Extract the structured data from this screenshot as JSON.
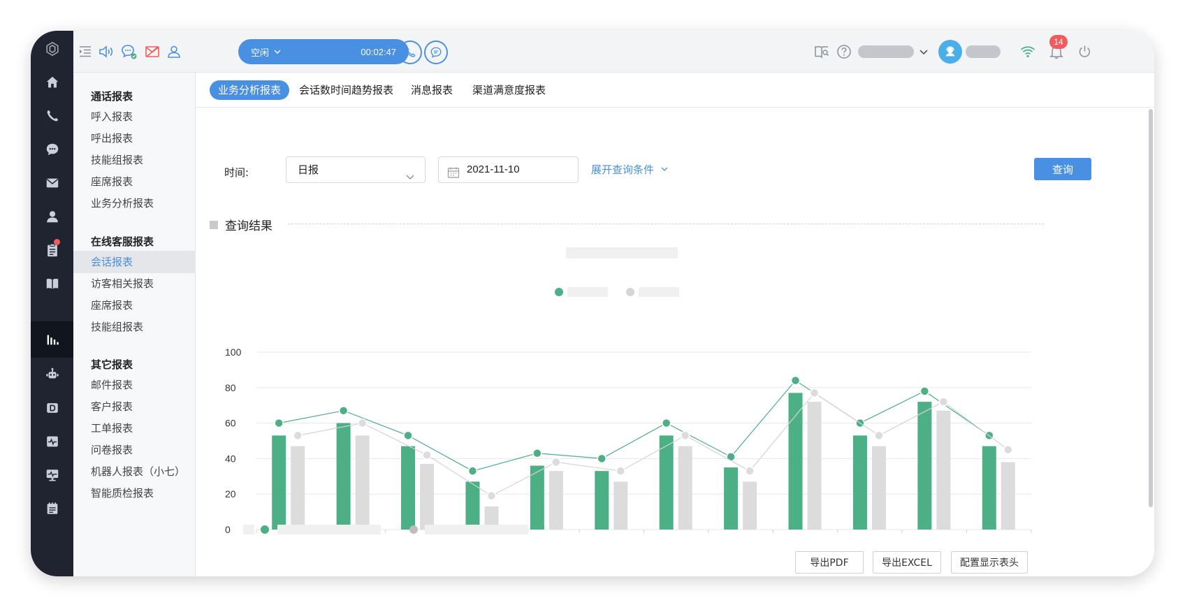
{
  "topbar": {
    "status_label": "空闲",
    "timer": "00:02:47",
    "notification_count": "14"
  },
  "submenu": {
    "groups": [
      {
        "title": "通话报表",
        "items": [
          "呼入报表",
          "呼出报表",
          "技能组报表",
          "座席报表",
          "业务分析报表"
        ]
      },
      {
        "title": "在线客服报表",
        "items": [
          "会话报表",
          "访客相关报表",
          "座席报表",
          "技能组报表"
        ]
      },
      {
        "title": "其它报表",
        "items": [
          "邮件报表",
          "客户报表",
          "工单报表",
          "问卷报表",
          "机器人报表（小七）",
          "智能质检报表"
        ]
      }
    ],
    "active_item": "会话报表"
  },
  "tabs": [
    "业务分析报表",
    "会话数时间趋势报表",
    "消息报表",
    "渠道满意度报表"
  ],
  "filters": {
    "time_label": "时间:",
    "period_value": "日报",
    "date_value": "2021-11-10",
    "expand_label": "展开查询条件",
    "query_button": "查询"
  },
  "results": {
    "title": "查询结果"
  },
  "chart_data": {
    "type": "bar",
    "title": "",
    "categories": [
      "",
      "",
      "",
      "",
      "",
      "",
      "",
      "",
      "",
      "",
      "",
      ""
    ],
    "ylim": [
      0,
      100
    ],
    "yticks": [
      "100",
      "80",
      "60",
      "40",
      "20",
      "0"
    ],
    "grid": true,
    "series": [
      {
        "kind": "bar",
        "color": "#4caf85",
        "values": [
          53,
          60,
          47,
          27,
          36,
          33,
          53,
          35,
          77,
          53,
          72,
          47
        ]
      },
      {
        "kind": "bar",
        "color": "#dcdcdc",
        "values": [
          47,
          53,
          37,
          13,
          33,
          27,
          47,
          27,
          72,
          47,
          67,
          38
        ]
      },
      {
        "kind": "line",
        "color": "#4caf85",
        "values": [
          60,
          67,
          53,
          33,
          43,
          40,
          60,
          41,
          84,
          60,
          78,
          53
        ]
      },
      {
        "kind": "line",
        "color": "#dcdcdc",
        "values": [
          53,
          60,
          42,
          19,
          38,
          33,
          53,
          33,
          77,
          53,
          72,
          45
        ]
      }
    ]
  },
  "export": {
    "pdf": "导出PDF",
    "excel": "导出EXCEL",
    "config": "配置显示表头"
  },
  "colors": {
    "accent": "#4a90e2",
    "rail": "#1f2430",
    "green": "#4caf85",
    "grey": "#dcdcdc",
    "badge": "#f25b5b"
  }
}
